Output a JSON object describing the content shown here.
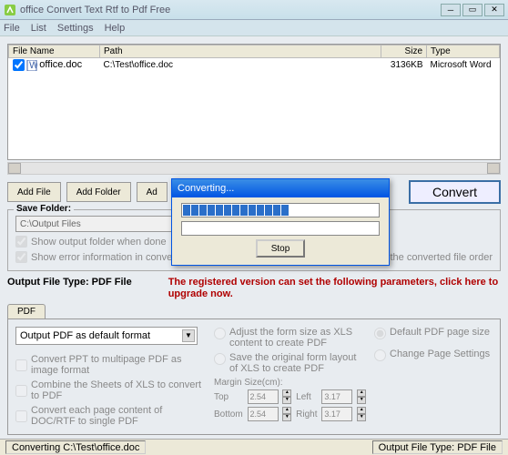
{
  "window": {
    "title": "office Convert Text Rtf to Pdf Free"
  },
  "menu": {
    "file": "File",
    "list": "List",
    "settings": "Settings",
    "help": "Help"
  },
  "table": {
    "cols": {
      "filename": "File Name",
      "path": "Path",
      "size": "Size",
      "type": "Type"
    },
    "rows": [
      {
        "checked": true,
        "filename": "office.doc",
        "path": "C:\\Test\\office.doc",
        "size": "3136KB",
        "type": "Microsoft Word"
      }
    ]
  },
  "buttons": {
    "addFile": "Add File",
    "addFolder": "Add Folder",
    "ad3": "Ad",
    "convert": "Convert"
  },
  "saveFolder": {
    "legend": "Save Folder:",
    "path": "C:\\Output Files",
    "showOutput": "Show output folder when done",
    "showError": "Show error information in conver",
    "includeOrder": "Include the converted file order"
  },
  "output": {
    "label": "Output File Type:  PDF File"
  },
  "promo": "The registered version can set the following parameters, click here to upgrade now.",
  "tab": {
    "pdf": "PDF"
  },
  "pdfPanel": {
    "combo": "Output PDF as default format",
    "chk1": "Convert PPT to multipage PDF as image format",
    "chk2": "Combine the Sheets of XLS to convert to PDF",
    "chk3": "Convert each page content of DOC/RTF to single PDF",
    "rad1": "Adjust the form size as XLS content to create PDF",
    "rad2": "Save the original form layout of XLS to create PDF",
    "marginLabel": "Margin Size(cm):",
    "top": "Top",
    "left": "Left",
    "bottom": "Bottom",
    "right": "Right",
    "topVal": "2.54",
    "leftVal": "3.17",
    "bottomVal": "2.54",
    "rightVal": "3.17",
    "rad3": "Default PDF page size",
    "rad4": "Change Page Settings"
  },
  "status": {
    "left": "Converting  C:\\Test\\office.doc",
    "right": "Output File Type:  PDF File"
  },
  "dialog": {
    "title": "Converting...",
    "stop": "Stop"
  }
}
